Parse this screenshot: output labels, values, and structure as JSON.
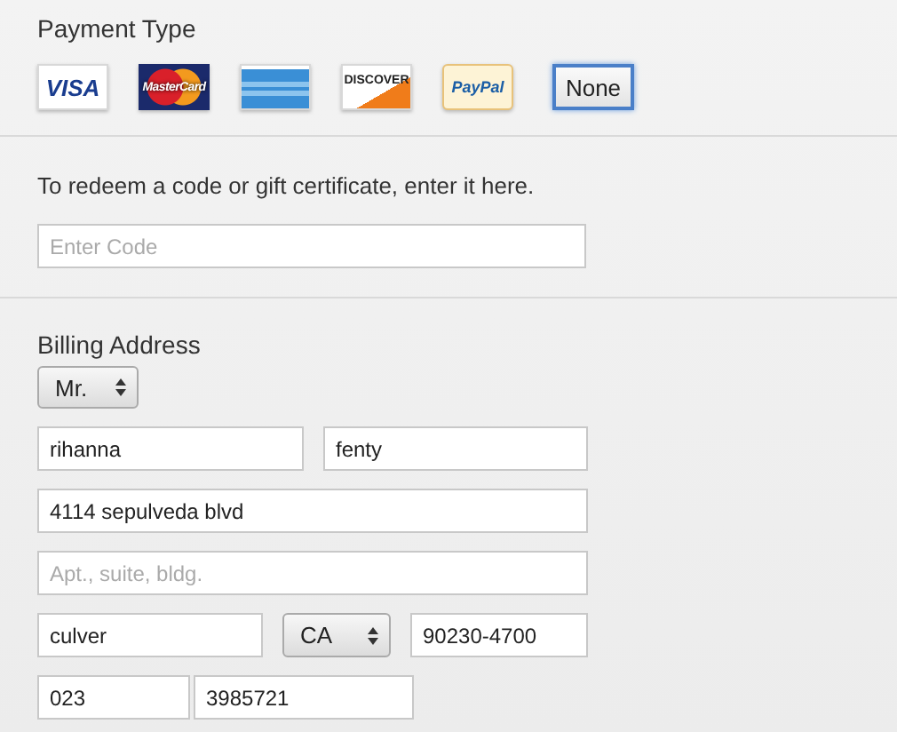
{
  "payment_type": {
    "heading": "Payment Type",
    "options": [
      {
        "kind": "visa",
        "label": "VISA",
        "selected": false
      },
      {
        "kind": "mastercard",
        "label": "MasterCard",
        "selected": false
      },
      {
        "kind": "amex",
        "selected": false
      },
      {
        "kind": "discover",
        "label": "DISCOVER",
        "selected": false
      },
      {
        "kind": "paypal",
        "label": "PayPal",
        "selected": false
      },
      {
        "kind": "text",
        "label": "None",
        "selected": true
      }
    ]
  },
  "redeem": {
    "prompt": "To redeem a code or gift certificate, enter it here.",
    "code_field": {
      "placeholder": "Enter Code"
    }
  },
  "billing_address": {
    "heading": "Billing Address",
    "title_select": {
      "value": "Mr."
    },
    "first_name": {
      "value": "rihanna"
    },
    "last_name": {
      "value": "fenty"
    },
    "street": {
      "value": "4114 sepulveda blvd"
    },
    "street_2": {
      "placeholder": "Apt., suite, bldg."
    },
    "city": {
      "value": "culver"
    },
    "state_select": {
      "value": "CA"
    },
    "zip": {
      "value": "90230-4700"
    },
    "area_code": {
      "value": "023"
    },
    "phone": {
      "value": "3985721"
    }
  }
}
